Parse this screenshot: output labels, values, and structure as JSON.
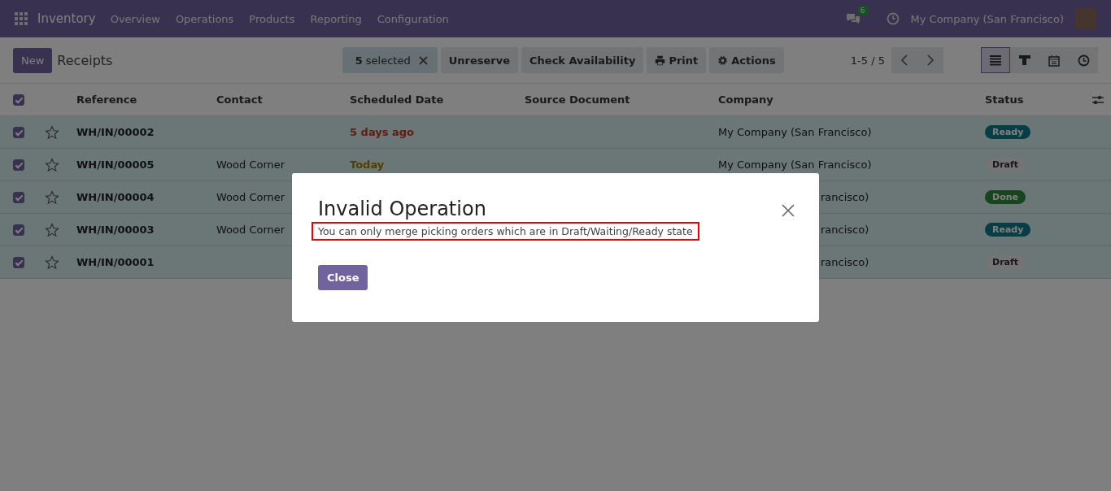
{
  "navbar": {
    "app": "Inventory",
    "menu": [
      "Overview",
      "Operations",
      "Products",
      "Reporting",
      "Configuration"
    ],
    "messages_count": "6",
    "company": "My Company (San Francisco)"
  },
  "control_panel": {
    "new_button": "New",
    "title": "Receipts",
    "selection": {
      "count": "5",
      "label": "selected"
    },
    "actions": [
      {
        "kind": "text",
        "label": "Unreserve"
      },
      {
        "kind": "text",
        "label": "Check Availability"
      },
      {
        "kind": "print",
        "label": "Print"
      },
      {
        "kind": "gear",
        "label": "Actions"
      }
    ],
    "pager": "1-5 / 5",
    "views": [
      {
        "kind": "list",
        "selected": true
      },
      {
        "kind": "kanban",
        "selected": false
      },
      {
        "kind": "calendar",
        "selected": false
      },
      {
        "kind": "activity",
        "selected": false
      }
    ]
  },
  "table": {
    "select_all": true,
    "columns": [
      "Reference",
      "Contact",
      "Scheduled Date",
      "Source Document",
      "Company",
      "Status"
    ],
    "rows": [
      {
        "checked": true,
        "reference": "WH/IN/00002",
        "date": {
          "text": "5 days ago",
          "kind": "late"
        },
        "company": {
          "text": "My Company (San Francisco)",
          "kind": "full"
        },
        "status": {
          "text": "Ready",
          "kind": "ready"
        }
      },
      {
        "checked": true,
        "reference": "WH/IN/00005",
        "contact": "Wood Corner",
        "date": {
          "text": "Today",
          "kind": "today"
        },
        "company": {
          "text": "My Company (San Francisco)",
          "kind": "full"
        },
        "status": {
          "text": "Draft",
          "kind": "draft"
        }
      },
      {
        "checked": true,
        "reference": "WH/IN/00004",
        "contact": "Wood Corner",
        "company": {
          "text": "rancisco)",
          "kind": "cut"
        },
        "status": {
          "text": "Done",
          "kind": "done"
        }
      },
      {
        "checked": true,
        "reference": "WH/IN/00003",
        "contact": "Wood Corner",
        "company": {
          "text": "rancisco)",
          "kind": "cut"
        },
        "status": {
          "text": "Ready",
          "kind": "ready"
        }
      },
      {
        "checked": true,
        "reference": "WH/IN/00001",
        "company": {
          "text": "rancisco)",
          "kind": "cut"
        },
        "status": {
          "text": "Draft",
          "kind": "draft"
        }
      }
    ]
  },
  "dialog": {
    "title": "Invalid Operation",
    "message": "You can only merge picking orders which are in Draft/Waiting/Ready state",
    "message_highlighted": true,
    "button": "Close"
  }
}
